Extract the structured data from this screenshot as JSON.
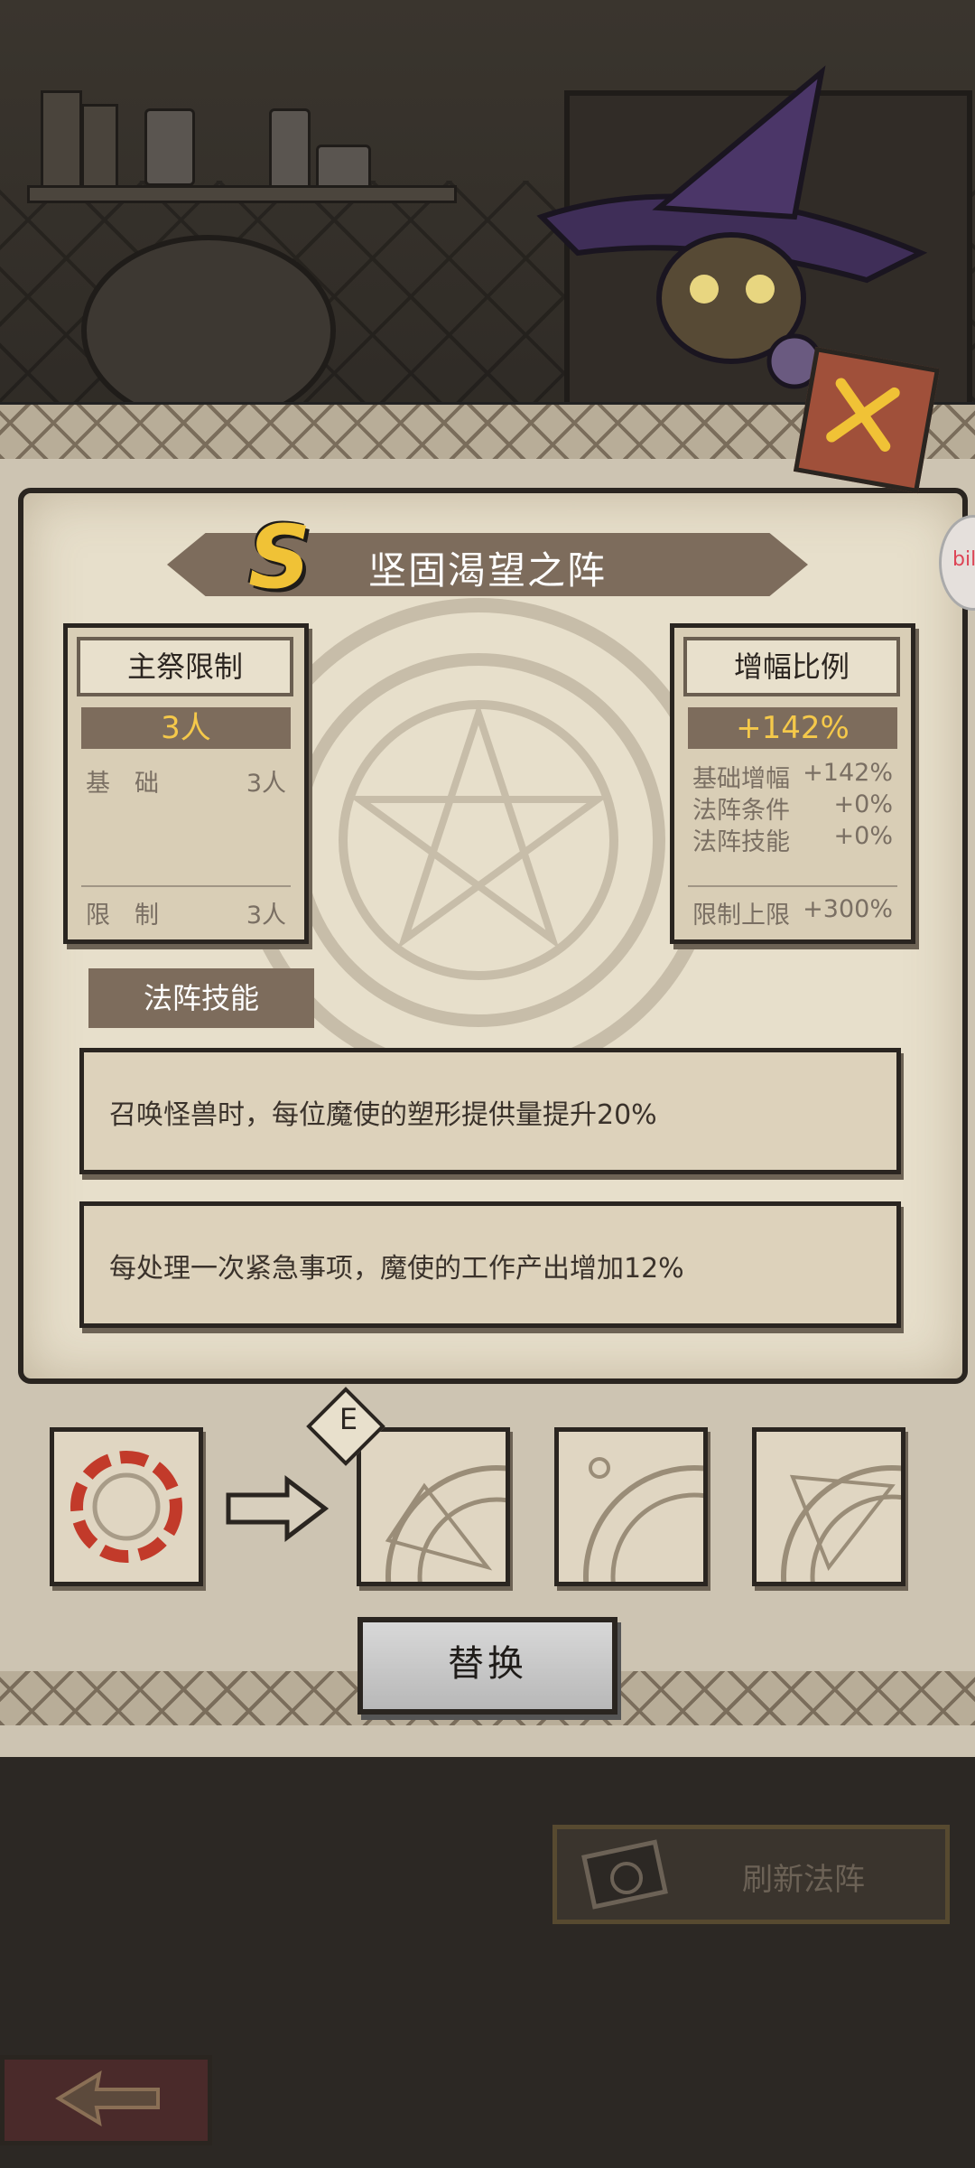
{
  "title": "坚固渴望之阵",
  "grade": "S",
  "left_card": {
    "header": "主祭限制",
    "value": "3人",
    "rows": [
      {
        "label": "基　础",
        "value": "3人"
      }
    ],
    "limit": {
      "label": "限　制",
      "value": "3人"
    }
  },
  "right_card": {
    "header": "增幅比例",
    "value": "+142%",
    "rows": [
      {
        "label": "基础增幅",
        "value": "+142%"
      },
      {
        "label": "法阵条件",
        "value": "+0%"
      },
      {
        "label": "法阵技能",
        "value": "+0%"
      }
    ],
    "limit": {
      "label": "限制上限",
      "value": "+300%"
    }
  },
  "skill_tab": "法阵技能",
  "skills": [
    "召唤怪兽时，每位魔使的塑形提供量提升20%",
    "每处理一次紧急事项，魔使的工作产出增加12%"
  ],
  "selected_badge": "E",
  "replace_button": "替换",
  "refresh_button": "刷新法阵",
  "side_popup": "bili",
  "colors": {
    "accent_gold": "#f5c94a",
    "banner": "#7d6c5c",
    "parchment": "#e7dfcb"
  }
}
